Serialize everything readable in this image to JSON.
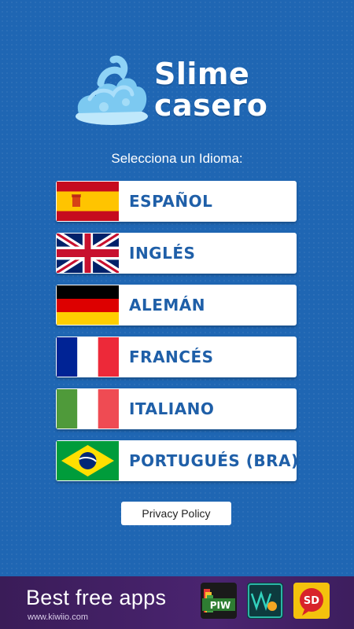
{
  "app": {
    "title_line1": "Slime",
    "title_line2": "casero"
  },
  "prompt": "Selecciona un Idioma:",
  "languages": [
    {
      "label": "ESPAÑOL",
      "flag": "spain-flag"
    },
    {
      "label": "INGLÉS",
      "flag": "uk-flag"
    },
    {
      "label": "ALEMÁN",
      "flag": "germany-flag"
    },
    {
      "label": "FRANCÉS",
      "flag": "france-flag"
    },
    {
      "label": "ITALIANO",
      "flag": "italy-flag"
    },
    {
      "label": "PORTUGUÉS (BRA)",
      "flag": "brazil-flag"
    }
  ],
  "privacy": {
    "label": "Privacy Policy"
  },
  "ad": {
    "headline": "Best free apps",
    "subtext": "www.kiwiio.com",
    "apps": [
      {
        "icon": "piw-app-icon",
        "label": "PIW"
      },
      {
        "icon": "waveform-app-icon"
      },
      {
        "icon": "sd-app-icon",
        "label": "SD"
      }
    ]
  },
  "colors": {
    "background": "#1f66b3",
    "label": "#1f5fa8",
    "ad_background": "#3a1c58"
  }
}
